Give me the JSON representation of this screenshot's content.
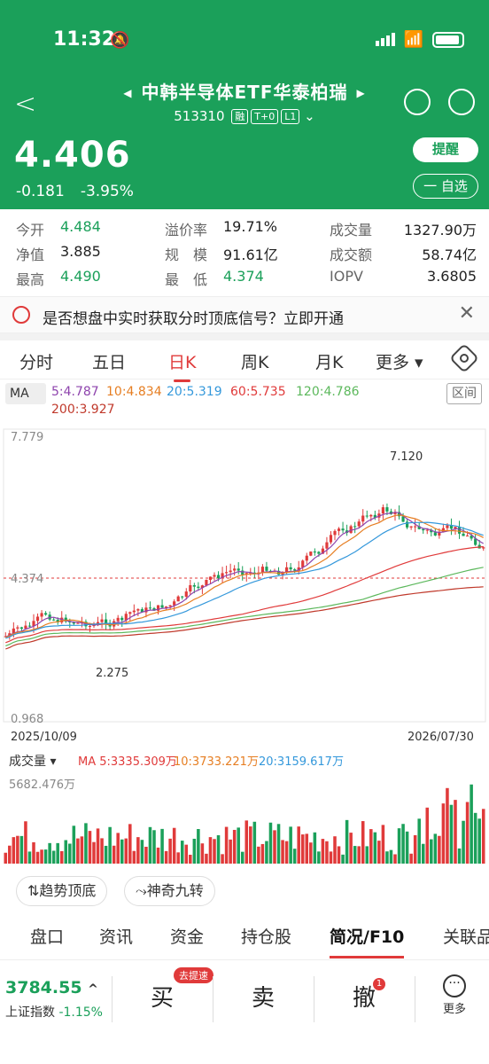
{
  "status": {
    "time": "11:32"
  },
  "header": {
    "title": "中韩半导体ETF华泰柏瑞",
    "code": "513310",
    "tags": [
      "融",
      "T+0",
      "L1"
    ],
    "price": "4.406",
    "change": "-0.181",
    "change_pct": "-3.95%",
    "remind_label": "提醒",
    "self_label": "一 自选"
  },
  "stats": [
    {
      "label": "今开",
      "value": "4.484"
    },
    {
      "label": "溢价率",
      "value": "19.71%"
    },
    {
      "label": "成交量",
      "value": "1327.90万"
    },
    {
      "label": "净值",
      "value": "3.885"
    },
    {
      "label": "规　模",
      "value": "91.61亿"
    },
    {
      "label": "成交额",
      "value": "58.74亿"
    },
    {
      "label": "最高",
      "value": "4.490"
    },
    {
      "label": "最　低",
      "value": "4.374"
    },
    {
      "label": "IOPV",
      "value": "3.6805"
    }
  ],
  "banner": {
    "text": "是否想盘中实时获取分时顶底信号？立即开通"
  },
  "ktabs": [
    "分时",
    "五日",
    "日K",
    "周K",
    "月K",
    "更多 ▾"
  ],
  "ma": {
    "button": "MA",
    "values": [
      "5:4.787",
      "10:4.834",
      "20:5.319",
      "60:5.735",
      "120:4.786",
      "200:3.927"
    ],
    "range": "区间",
    "colors": [
      "#8e44ad",
      "#e67e22",
      "#3498db",
      "#e03a3a",
      "#5cb85c",
      "#c0392b"
    ]
  },
  "kchart": {
    "ymax": "7.779",
    "ymin": "0.968",
    "cur": "4.374",
    "high_mark": "7.120",
    "low_mark": "2.275",
    "date_start": "2025/10/09",
    "date_end": "2026/07/30"
  },
  "volume": {
    "label": "成交量 ▾",
    "ma": [
      "MA 5:3335.309万",
      "10:3733.221万",
      "20:3159.617万"
    ],
    "max": "5682.476万"
  },
  "pills": [
    "⇅趋势顶底",
    "⤳神奇九转"
  ],
  "btabs": [
    "盘口",
    "资讯",
    "资金",
    "持仓股",
    "简况/F10",
    "关联品"
  ],
  "bottom": {
    "index_value": "3784.55",
    "index_name": "上证指数",
    "index_pct": "-1.15%",
    "buy": "买",
    "buy_badge": "去提速",
    "sell": "卖",
    "cancel": "撤",
    "cancel_badge": "1",
    "more": "更多"
  }
}
